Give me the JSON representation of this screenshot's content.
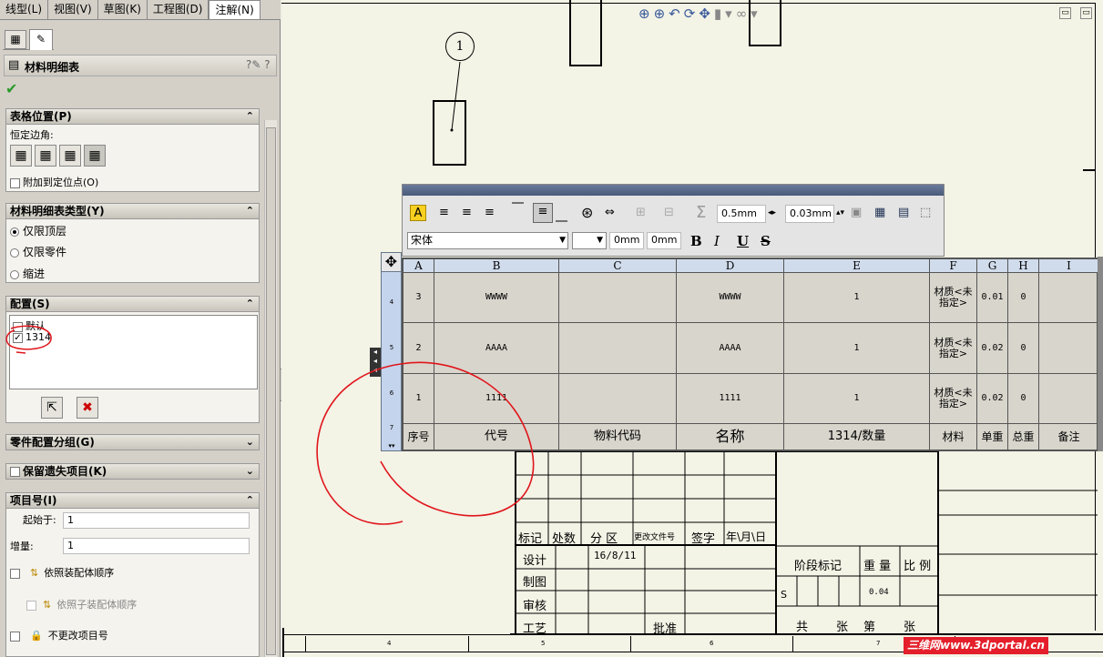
{
  "tabs": [
    "线型(L)",
    "视图(V)",
    "草图(K)",
    "工程图(D)",
    "注解(N)"
  ],
  "panel": {
    "title": "材料明细表",
    "table_position": {
      "header": "表格位置(P)",
      "anchor_label": "恒定边角:",
      "attach_label": "附加到定位点(O)"
    },
    "bom_type": {
      "header": "材料明细表类型(Y)",
      "options": [
        "仅限顶层",
        "仅限零件",
        "缩进"
      ]
    },
    "config": {
      "header": "配置(S)",
      "items": [
        "默认",
        "1314"
      ]
    },
    "part_config_group": "零件配置分组(G)",
    "keep_missing": "保留遗失项目(K)",
    "item_number": {
      "header": "项目号(I)",
      "start_label": "起始于:",
      "start_value": "1",
      "increment_label": "增量:",
      "increment_value": "1",
      "follow_assembly": "依照装配体顺序",
      "follow_subassembly": "依照子装配体顺序",
      "no_change": "不更改项目号"
    }
  },
  "balloon": "1",
  "format_toolbar": {
    "border_width": "0.5mm",
    "border_width2": "0.03mm",
    "font": "宋体",
    "size1": "0mm",
    "size2": "0mm"
  },
  "bom": {
    "columns": [
      "A",
      "B",
      "C",
      "D",
      "E",
      "F",
      "G",
      "H",
      "I"
    ],
    "row_numbers": [
      "4",
      "5",
      "6",
      "7"
    ],
    "rows": [
      [
        "3",
        "WWWW",
        "",
        "WWWW",
        "1",
        "材质<未指定>",
        "0.01",
        "0",
        ""
      ],
      [
        "2",
        "AAAA",
        "",
        "AAAA",
        "1",
        "材质<未指定>",
        "0.02",
        "0",
        ""
      ],
      [
        "1",
        "1111",
        "",
        "1111",
        "1",
        "材质<未指定>",
        "0.02",
        "0",
        ""
      ],
      [
        "序号",
        "代号",
        "物料代码",
        "名称",
        "1314/数量",
        "材料",
        "单重",
        "总重",
        "备注"
      ]
    ]
  },
  "title_block": {
    "headers": [
      "标记",
      "处数",
      "分 区",
      "更改文件号",
      "签字",
      "年\\月\\日"
    ],
    "design": "设计",
    "date": "16/8/11",
    "drawing": "制图",
    "review": "审核",
    "process": "工艺",
    "approve": "批准",
    "stage": "阶段标记",
    "weight": "重 量",
    "scale": "比 例",
    "s_mark": "S",
    "weight_value": "0.04",
    "sheet_total": "共",
    "sheet_unit": "张",
    "sheet_num": "第",
    "sheet_unit2": "张"
  },
  "bottom_zones": [
    "4",
    "5",
    "6",
    "7"
  ],
  "watermark": "三维网www.3dportal.cn"
}
